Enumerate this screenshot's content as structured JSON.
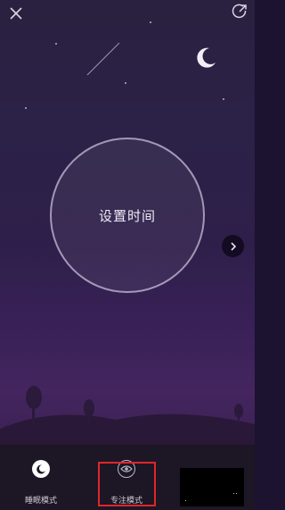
{
  "header": {
    "close_icon": "close-icon",
    "share_icon": "share-icon"
  },
  "main": {
    "set_time_label": "设置时间",
    "next_icon": "chevron-right-icon"
  },
  "modes": [
    {
      "label": "睡眠模式",
      "icon": "moon-icon",
      "selected": false
    },
    {
      "label": "专注模式",
      "icon": "eye-icon",
      "selected": true
    }
  ],
  "colors": {
    "highlight": "#e0262b",
    "background": "#2c2147",
    "bottom_bar": "#1d1624"
  }
}
